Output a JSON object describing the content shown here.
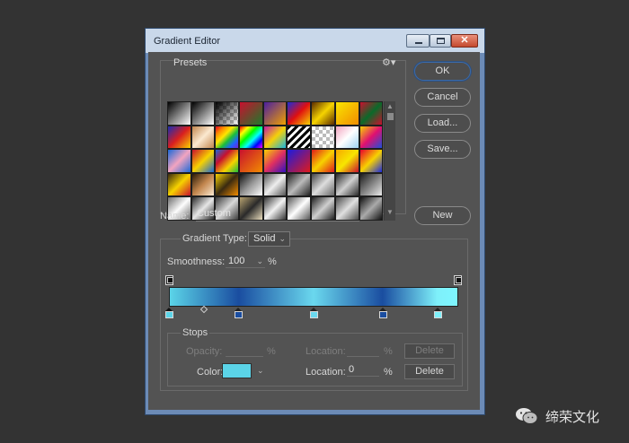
{
  "window": {
    "title": "Gradient Editor",
    "close_glyph": "✕"
  },
  "presets": {
    "label": "Presets",
    "gear_glyph": "⚙▾",
    "scroll_up": "▲",
    "scroll_down": "▼",
    "swatches": [
      "linear-gradient(135deg,#000,#fff)",
      "linear-gradient(135deg,#000,#fff)",
      "linear-gradient(135deg,#000 0%,rgba(0,0,0,0) 100%),repeating-conic-gradient(#bbb 0% 25%,#fff 0% 50%) 0 0/8px 8px",
      "linear-gradient(135deg,#c8102e,#1d7a2c)",
      "linear-gradient(135deg,#4b1fa0,#f0a000)",
      "linear-gradient(135deg,#1e2bd8,#e01010,#f6d400)",
      "linear-gradient(135deg,#5a2a00,#f6d400,#5a2a00)",
      "linear-gradient(135deg,#f9e600,#f28c00)",
      "linear-gradient(135deg,#c8102e,#0a6a2a,#c8102e)",
      "linear-gradient(135deg,#1a2db3,#d91f1f,#f7d200)",
      "linear-gradient(135deg,#c2864e,#fbe9d0,#c2864e)",
      "linear-gradient(135deg,#e30022,#ff8a00,#ffe600,#1bbf3a,#1e64ff,#7a1fd6)",
      "linear-gradient(135deg,#ff0000,#ffff00,#00ff00,#00ffff,#0000ff,#ff00ff)",
      "linear-gradient(135deg,#c01aa8,#f4d10a,#18b4e0)",
      "repeating-linear-gradient(135deg,#000 0 3px,#fff 3px 6px)",
      "repeating-conic-gradient(#bbb 0% 25%,#fff 0% 50%) 0 0/8px 8px",
      "linear-gradient(135deg,#f2a4c0,#fff,#9fd4f2)",
      "linear-gradient(135deg,#f7d200,#e01070,#1e4fd8)",
      "linear-gradient(135deg,#1b68d8,#f2a4c0,#1b68d8)",
      "linear-gradient(135deg,#c8102e,#f7d200,#1b68d8)",
      "linear-gradient(135deg,#1b68d8,#c8102e,#f7d200,#1bbf3a)",
      "linear-gradient(135deg,#c8102e,#f28c00)",
      "linear-gradient(135deg,#f7d200,#e03060,#3010c0)",
      "linear-gradient(135deg,#1b1be0,#e01a1a)",
      "linear-gradient(135deg,#e01a1a,#f7d200,#e01a1a)",
      "linear-gradient(135deg,#f7a800,#f7e600,#c8102e)",
      "linear-gradient(135deg,#e8002d,#f7d200,#1b2be0)",
      "linear-gradient(135deg,#3a2a10,#f7d200,#c8102e)",
      "linear-gradient(135deg,#2b1a05,#c2864e,#fbe9d0)",
      "linear-gradient(135deg,#f7d200,#3a2a10,#f28c00)",
      "linear-gradient(135deg,#111,#999,#fff)",
      "linear-gradient(135deg,#555,#eee,#555)",
      "linear-gradient(135deg,#222,#bbb,#222)",
      "linear-gradient(135deg,#444,#ddd,#666)",
      "linear-gradient(135deg,#2a2a2a,#cfcfcf,#2a2a2a)",
      "linear-gradient(135deg,#1b1b1b,#eaeaea)",
      "linear-gradient(135deg,#6d6d6d,#fdfdfd,#6d6d6d)",
      "linear-gradient(135deg,#2a2a2a,#e6e6e6,#2a2a2a)",
      "linear-gradient(135deg,#3b3b3b,#d9d9d9,#3b3b3b)",
      "linear-gradient(135deg,#b7a270,#2a2a2a,#e9dcbc)",
      "linear-gradient(135deg,#333,#f2f2f2,#333)",
      "linear-gradient(135deg,#555,#fff,#555)",
      "linear-gradient(135deg,#1e1e1e,#cfcfcf,#1e1e1e)",
      "linear-gradient(135deg,#4a4a4a,#e0e0e0,#4a4a4a)",
      "linear-gradient(135deg,#111,#aaa,#111)",
      "linear-gradient(135deg,#2e2e2e,#d8d8d8,#2e2e2e)",
      "linear-gradient(135deg,#444,#eee,#444)",
      "linear-gradient(135deg,#111,#999,#111)",
      "linear-gradient(135deg,#1e2a40,#cfd8e6,#1e2a40)",
      "linear-gradient(135deg,#2a2a2a,#e8e8e8,#2a2a2a)",
      "linear-gradient(135deg,#333,#fafafa,#333)",
      "linear-gradient(135deg,#5a4a20,#e8dcb8,#5a4a20)",
      "linear-gradient(135deg,#222,#ddd,#222)",
      "linear-gradient(135deg,#3a3a3a,#f0f0f0,#3a3a3a)",
      "linear-gradient(135deg,#1a1a1a,#c8c8c8,#1a1a1a)",
      "linear-gradient(135deg,#666,#fff,#666)",
      "linear-gradient(135deg,#2a2a2a,#ededed,#2a2a2a)",
      "linear-gradient(135deg,#141414,#bcbcbc,#141414)",
      "linear-gradient(135deg,#3a3a3a,#e6e6e6,#3a3a3a)",
      "linear-gradient(135deg,#262626,#dadada,#262626)",
      "linear-gradient(135deg,#444,#f5f5f5,#444)",
      "linear-gradient(135deg,#2b2b2b,#c0c0c0,#2b2b2b)",
      "linear-gradient(135deg,#555,#e8e8e8,#555)"
    ]
  },
  "buttons": {
    "ok": "OK",
    "cancel": "Cancel",
    "load": "Load...",
    "save": "Save...",
    "new": "New"
  },
  "name": {
    "label": "Name:",
    "value": "Custom"
  },
  "gradient": {
    "type_label": "Gradient Type:",
    "type_value": "Solid",
    "smoothness_label": "Smoothness:",
    "smoothness_value": "100",
    "smoothness_unit": "%",
    "chevron": "⌄",
    "color_stops": [
      {
        "location": 0,
        "color": "#5bd4e8"
      },
      {
        "location": 24,
        "color": "#1a4da0"
      },
      {
        "location": 50,
        "color": "#6ad8ee"
      },
      {
        "location": 74,
        "color": "#1a4da0"
      },
      {
        "location": 93,
        "color": "#7ef0fa"
      },
      {
        "location": 100,
        "color": "#7ef6ff"
      }
    ],
    "opacity_stops": [
      {
        "location": 0
      },
      {
        "location": 100
      }
    ],
    "midpoint_location": 12
  },
  "stops": {
    "label": "Stops",
    "opacity_label": "Opacity:",
    "opacity_unit": "%",
    "location_label": "Location:",
    "location_unit": "%",
    "delete_label": "Delete",
    "color_label": "Color:",
    "color_value": "#5bd4e8",
    "color_location": "0",
    "color_unit": "%"
  },
  "watermark": {
    "text": "缔荣文化"
  },
  "colors": {
    "panel": "#535353",
    "titlebar": "#c9d8ea",
    "accent": "#3b6aa8"
  }
}
